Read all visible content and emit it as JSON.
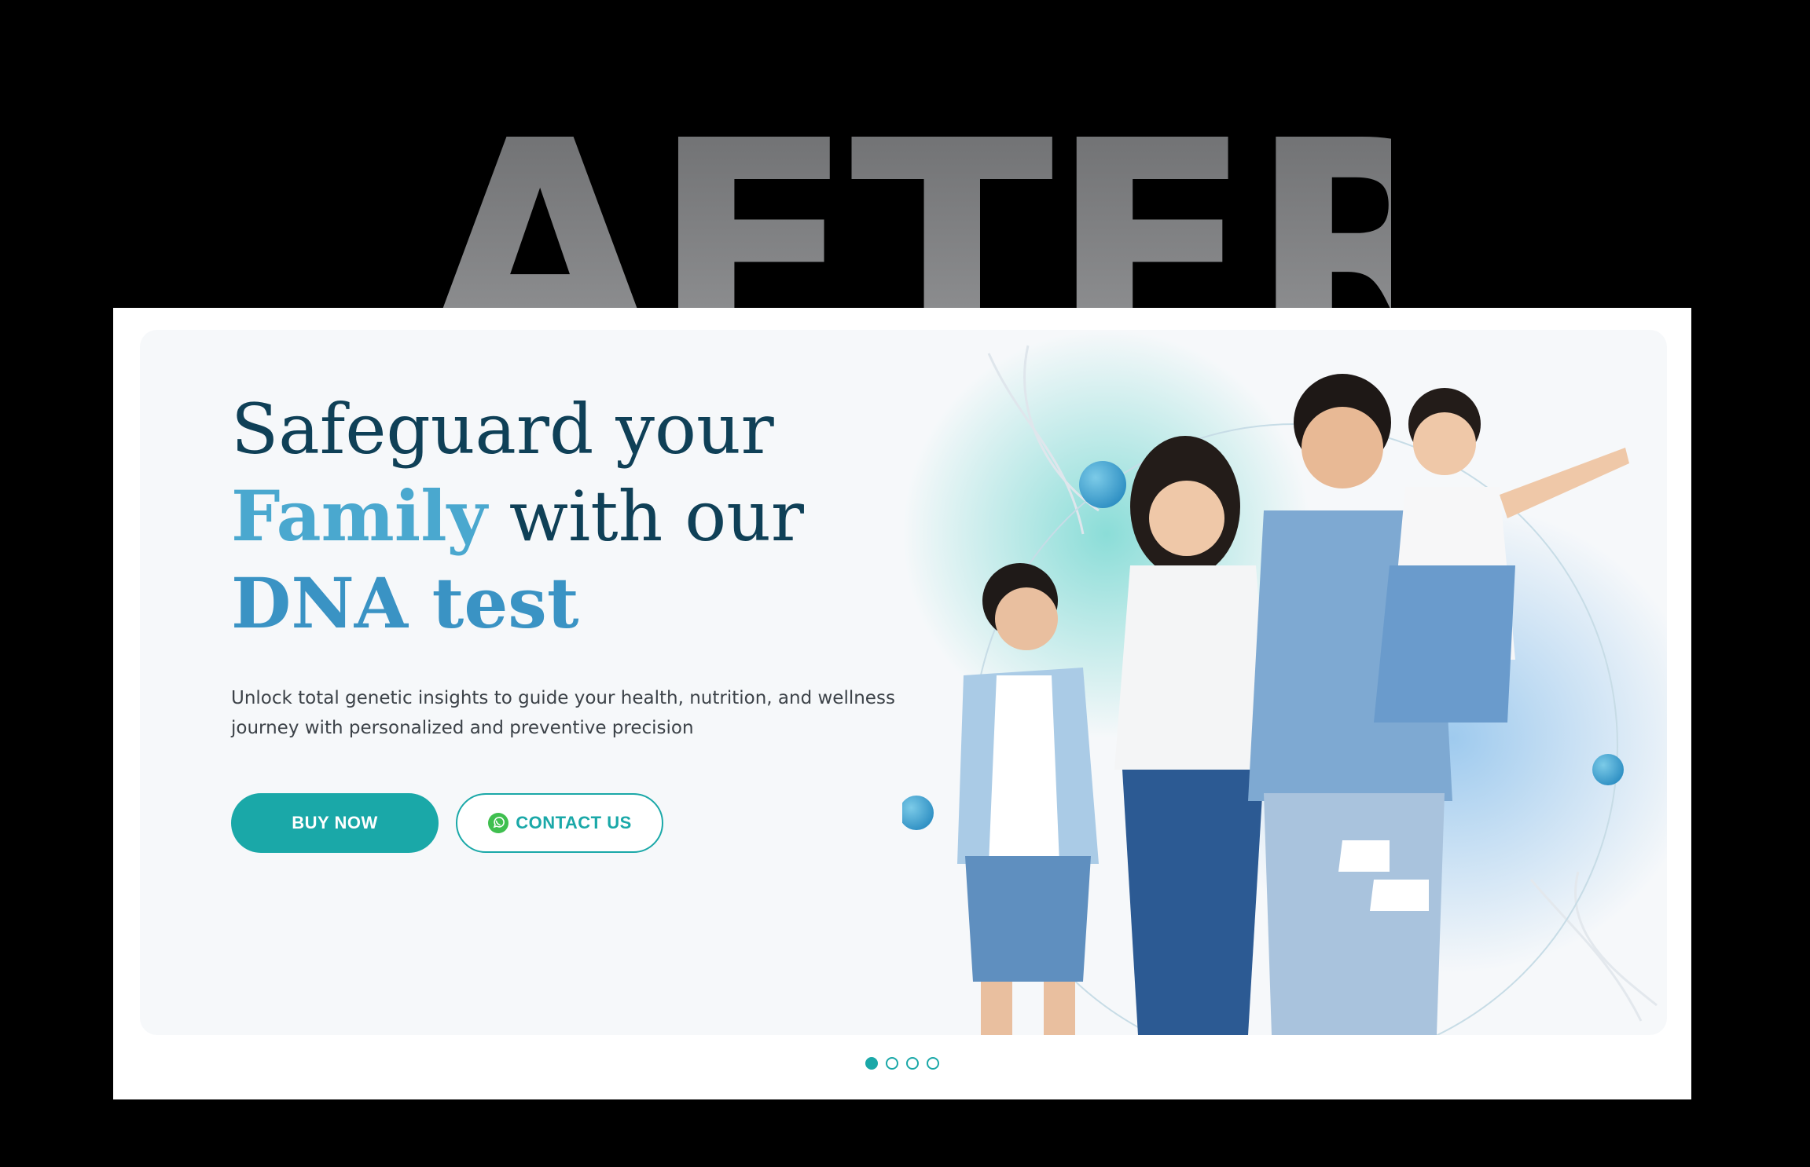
{
  "overlay": {
    "label": "AFTER"
  },
  "hero": {
    "headline": {
      "line1": "Safeguard your",
      "line2_accent": "Family",
      "line2_rest": " with our",
      "line3": "DNA test"
    },
    "subtitle_line1": "Unlock total genetic insights to guide your health, nutrition, and wellness",
    "subtitle_line2": "journey with personalized and preventive precision",
    "buy_label": "BUY NOW",
    "contact_label": "CONTACT US"
  },
  "icons": {
    "contact": "whatsapp-icon"
  },
  "image": {
    "subject": "family-photo"
  },
  "carousel": {
    "count": 4,
    "active_index": 0
  },
  "colors": {
    "primary": "#1aa8a8",
    "headline": "#0f4057",
    "accent": "#4aa8cf",
    "background": "#f6f8fa"
  }
}
